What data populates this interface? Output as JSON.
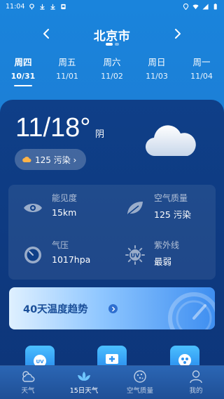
{
  "status_bar": {
    "time": "11:04"
  },
  "header": {
    "city": "北京市"
  },
  "day_tabs": [
    {
      "weekday": "周四",
      "date": "10/31",
      "active": true
    },
    {
      "weekday": "周五",
      "date": "11/01",
      "active": false
    },
    {
      "weekday": "周六",
      "date": "11/02",
      "active": false
    },
    {
      "weekday": "周日",
      "date": "11/03",
      "active": false
    },
    {
      "weekday": "周一",
      "date": "11/04",
      "active": false
    }
  ],
  "current": {
    "temp_range": "11/18°",
    "condition": "阴",
    "aqi_label": "125 污染 ›"
  },
  "details": {
    "visibility": {
      "label": "能见度",
      "value": "15km"
    },
    "air_quality": {
      "label": "空气质量",
      "value": "125 污染"
    },
    "pressure": {
      "label": "气压",
      "value": "1017hpa"
    },
    "uv": {
      "label": "紫外线",
      "value": "最弱"
    }
  },
  "trend_banner": {
    "text": "40天温度趋势"
  },
  "bottom_nav": [
    {
      "label": "天气",
      "active": false
    },
    {
      "label": "15日天气",
      "active": true
    },
    {
      "label": "空气质量",
      "active": false
    },
    {
      "label": "我的",
      "active": false
    }
  ],
  "colors": {
    "accent": "#1a84dc",
    "card": "#0f3f88",
    "banner_text": "#1b4f99"
  }
}
